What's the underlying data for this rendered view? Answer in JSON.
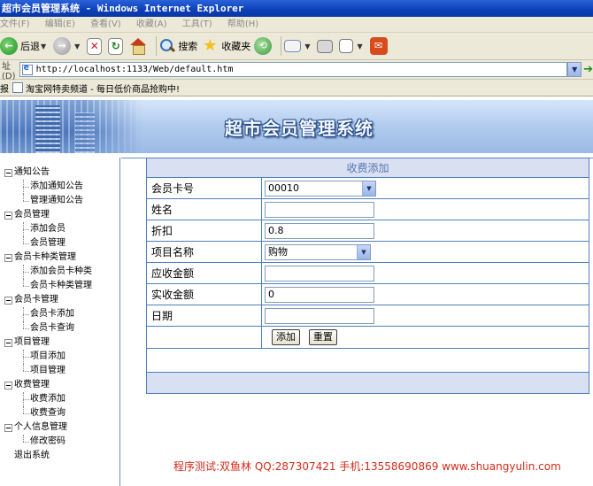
{
  "window": {
    "title": "超市会员管理系统 - Windows Internet Explorer"
  },
  "menu": [
    "文件(F)",
    "编辑(E)",
    "查看(V)",
    "收藏(A)",
    "工具(T)",
    "帮助(H)"
  ],
  "toolbar": {
    "back": "后退",
    "search": "搜索",
    "favorites": "收藏夹"
  },
  "address": {
    "label": "址(D)",
    "url": "http://localhost:1133/Web/default.htm"
  },
  "links": {
    "label": "报",
    "item": "淘宝网特卖频道 - 每日低价商品抢购中!"
  },
  "banner": {
    "title": "超市会员管理系统"
  },
  "sidebar": {
    "groups": [
      {
        "label": "通知公告",
        "children": [
          "添加通知公告",
          "管理通知公告"
        ]
      },
      {
        "label": "会员管理",
        "children": [
          "添加会员",
          "会员管理"
        ]
      },
      {
        "label": "会员卡种类管理",
        "children": [
          "添加会员卡种类",
          "会员卡种类管理"
        ]
      },
      {
        "label": "会员卡管理",
        "children": [
          "会员卡添加",
          "会员卡查询"
        ]
      },
      {
        "label": "项目管理",
        "children": [
          "项目添加",
          "项目管理"
        ]
      },
      {
        "label": "收费管理",
        "children": [
          "收费添加",
          "收费查询"
        ]
      },
      {
        "label": "个人信息管理",
        "children": [
          "修改密码"
        ]
      }
    ],
    "logout": "退出系统"
  },
  "form": {
    "caption": "收费添加",
    "fields": {
      "card_no": {
        "label": "会员卡号",
        "value": "00010"
      },
      "name": {
        "label": "姓名",
        "value": ""
      },
      "discount": {
        "label": "折扣",
        "value": "0.8"
      },
      "item": {
        "label": "项目名称",
        "value": "购物"
      },
      "receivable": {
        "label": "应收金额",
        "value": ""
      },
      "received": {
        "label": "实收金额",
        "value": "0"
      },
      "date": {
        "label": "日期",
        "value": ""
      }
    },
    "buttons": {
      "add": "添加",
      "reset": "重置"
    }
  },
  "credit": "程序测试:双鱼林 QQ:287307421 手机:13558690869 www.shuangyulin.com"
}
